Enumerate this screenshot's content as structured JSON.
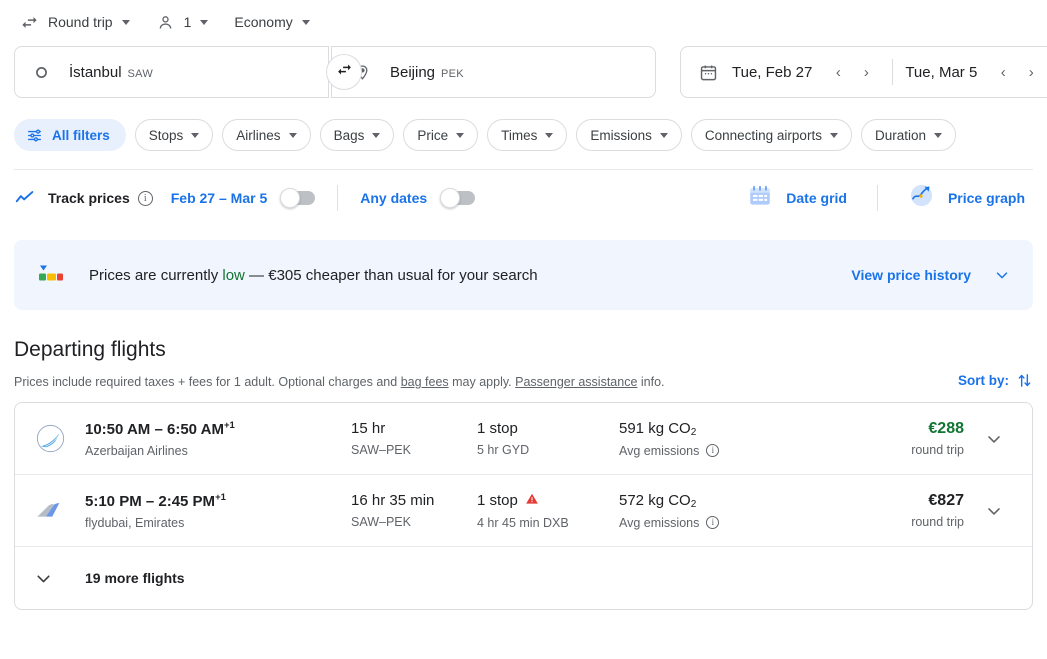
{
  "options": {
    "trip_type": {
      "label": "Round trip",
      "icon": "swap-horizontal-icon"
    },
    "passengers": {
      "label": "1",
      "icon": "person-icon"
    },
    "cabin_class": {
      "label": "Economy"
    }
  },
  "search": {
    "origin": {
      "city": "İstanbul",
      "code": "SAW",
      "icon": "circle-icon"
    },
    "destination": {
      "city": "Beijing",
      "code": "PEK",
      "icon": "location-pin-icon"
    },
    "swap_icon": "swap-arrows-icon",
    "calendar_icon": "calendar-icon",
    "depart_date": "Tue, Feb 27",
    "return_date": "Tue, Mar 5",
    "prev_arrow": "‹",
    "next_arrow": "›"
  },
  "filters": [
    {
      "label": "All filters",
      "primary": true,
      "has_caret": false,
      "icon": "tune-icon"
    },
    {
      "label": "Stops",
      "primary": false,
      "has_caret": true
    },
    {
      "label": "Airlines",
      "primary": false,
      "has_caret": true
    },
    {
      "label": "Bags",
      "primary": false,
      "has_caret": true
    },
    {
      "label": "Price",
      "primary": false,
      "has_caret": true
    },
    {
      "label": "Times",
      "primary": false,
      "has_caret": true
    },
    {
      "label": "Emissions",
      "primary": false,
      "has_caret": true
    },
    {
      "label": "Connecting airports",
      "primary": false,
      "has_caret": true
    },
    {
      "label": "Duration",
      "primary": false,
      "has_caret": true
    }
  ],
  "track_prices": {
    "label": "Track prices",
    "info_glyph": "i",
    "date_range": "Feb 27 – Mar 5",
    "range_toggle_on": false,
    "any_dates_label": "Any dates",
    "any_dates_toggle_on": false,
    "date_grid_label": "Date grid",
    "price_graph_label": "Price graph"
  },
  "banner": {
    "text_before": "Prices are currently ",
    "highlight": "low",
    "text_after": " — €305 cheaper than usual for your search",
    "link_label": "View price history",
    "chevron_icon": "chevron-down-icon",
    "background": "#f1f6fe",
    "highlight_color": "#137333"
  },
  "departing": {
    "title": "Departing flights",
    "disclaimer_1": "Prices include required taxes + fees for 1 adult. Optional charges and ",
    "link_bag_fees": "bag fees",
    "disclaimer_2": " may apply. ",
    "link_passenger": "Passenger assistance",
    "disclaimer_3": " info.",
    "sort_label": "Sort by:",
    "sort_icon": "sort-arrows-icon"
  },
  "flights": [
    {
      "airline_logo": "azerbaijan-airlines-logo",
      "times": "10:50 AM – 6:50 AM",
      "day_offset": "+1",
      "airlines": "Azerbaijan Airlines",
      "duration": "15 hr",
      "route": "SAW–PEK",
      "stops": "1 stop",
      "has_warning": false,
      "layover": "5 hr GYD",
      "emissions": "591 kg CO",
      "emissions_sub": "2",
      "emissions_label": "Avg emissions",
      "price": "€288",
      "price_cheap": true,
      "price_sub": "round trip",
      "expand_icon": "chevron-down-icon"
    },
    {
      "airline_logo": "flydubai-logo",
      "times": "5:10 PM – 2:45 PM",
      "day_offset": "+1",
      "airlines": "flydubai, Emirates",
      "duration": "16 hr 35 min",
      "route": "SAW–PEK",
      "stops": "1 stop",
      "has_warning": true,
      "layover": "4 hr 45 min DXB",
      "emissions": "572 kg CO",
      "emissions_sub": "2",
      "emissions_label": "Avg emissions",
      "price": "€827",
      "price_cheap": false,
      "price_sub": "round trip",
      "expand_icon": "chevron-down-icon"
    }
  ],
  "more_flights": {
    "label": "19 more flights",
    "icon": "chevron-down-icon"
  }
}
